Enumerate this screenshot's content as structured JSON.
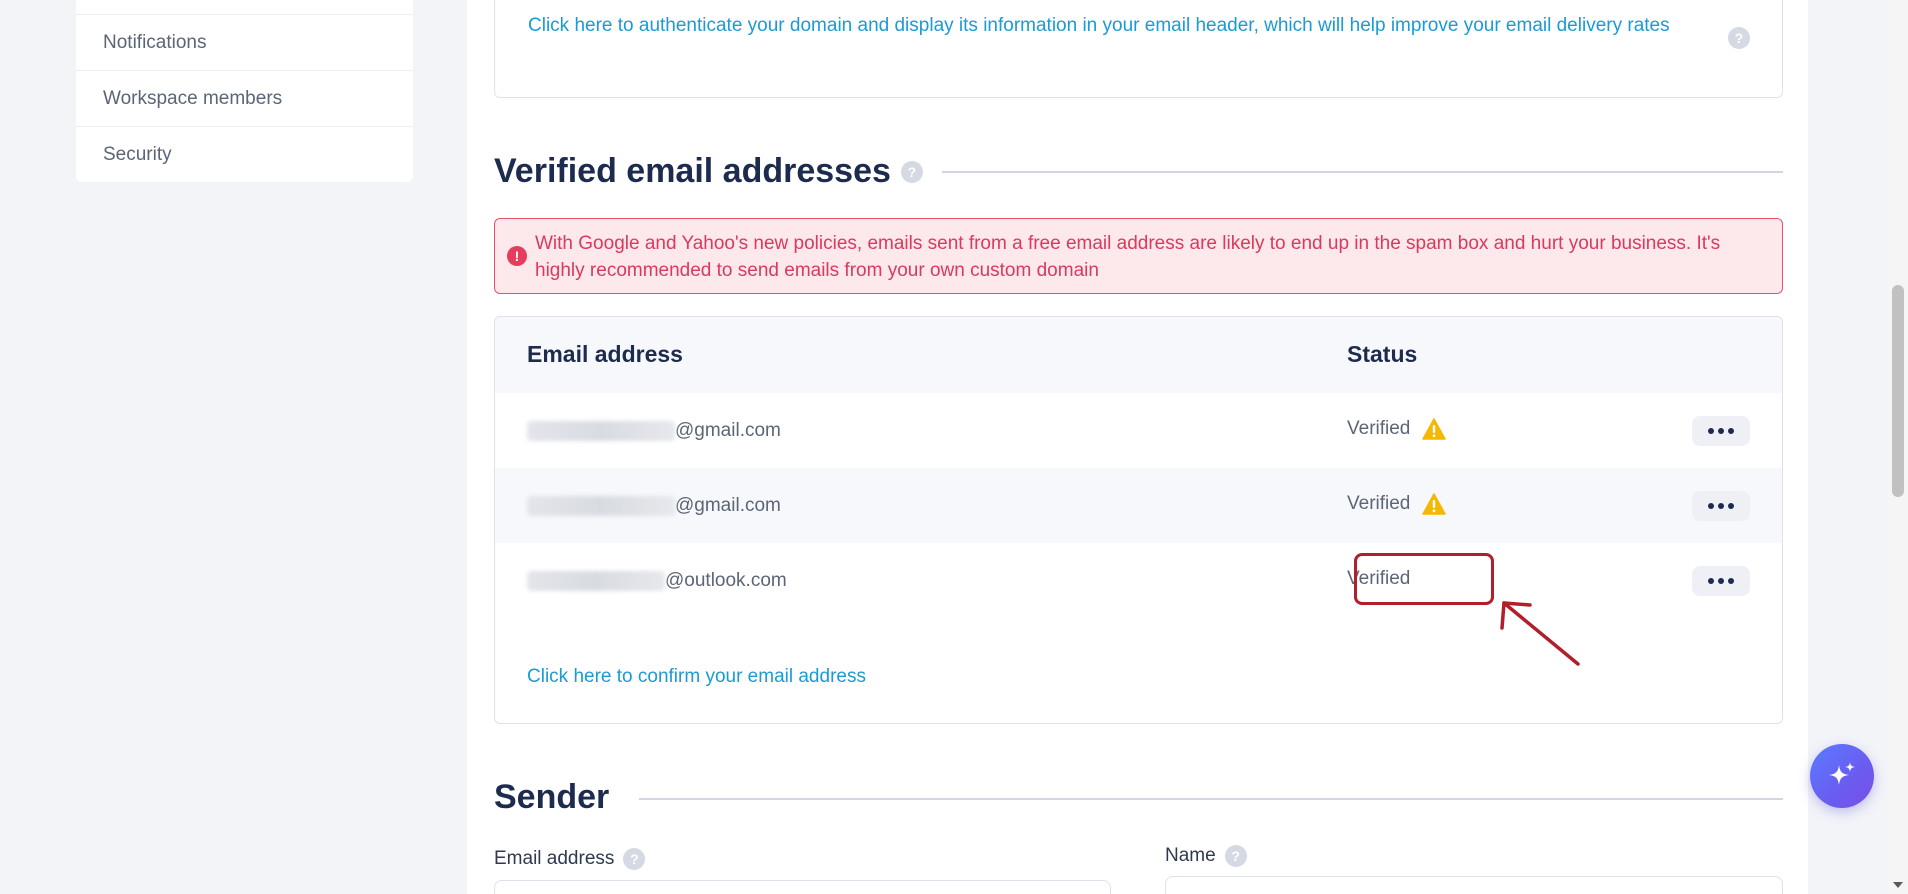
{
  "sidebar": {
    "items": [
      {
        "label": "Notifications"
      },
      {
        "label": "Workspace members"
      },
      {
        "label": "Security"
      }
    ]
  },
  "domain_auth": {
    "link_text": "Click here to authenticate your domain and display its information in your email header, which will help improve your email delivery rates",
    "help": "?"
  },
  "verified_section": {
    "title": "Verified email addresses",
    "help": "?",
    "alert": "With Google and Yahoo's new policies, emails sent from a free email address are likely to end up in the spam box and hurt your business. It's highly recommended to send emails from your own custom domain",
    "alert_icon": "!",
    "table": {
      "headers": {
        "email": "Email address",
        "status": "Status"
      },
      "rows": [
        {
          "email_domain": "@gmail.com",
          "status": "Verified",
          "warning": true,
          "warning_icon": "warning-icon"
        },
        {
          "email_domain": "@gmail.com",
          "status": "Verified",
          "warning": true,
          "warning_icon": "warning-icon"
        },
        {
          "email_domain": "@outlook.com",
          "status": "Verified",
          "warning": false
        }
      ],
      "confirm_link": "Click here to confirm your email address"
    }
  },
  "sender_section": {
    "title": "Sender",
    "email_label": "Email address",
    "name_label": "Name",
    "help": "?"
  },
  "colors": {
    "accent_link": "#1a9bd7",
    "alert_red": "#e63d5f",
    "heading": "#1d2b4f",
    "warning": "#f5b800",
    "annotation": "#b01f2a"
  }
}
